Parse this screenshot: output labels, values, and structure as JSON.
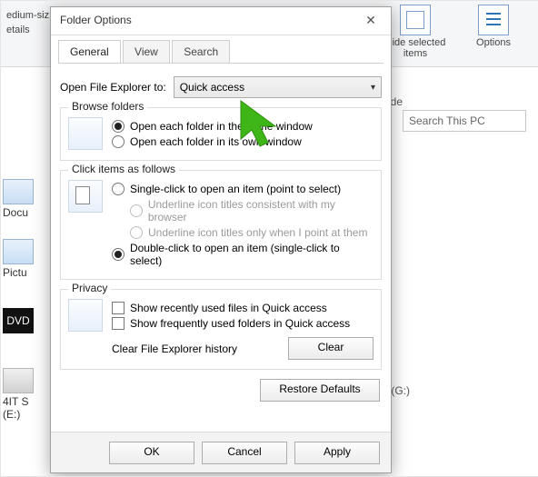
{
  "ribbon": {
    "frag_size": "edium-siz",
    "frag_details": "etails",
    "hide_label_l1": "Hide selected",
    "hide_label_l2": "items",
    "options_label": "Options"
  },
  "bg": {
    "ide": "ide",
    "search_placeholder": "Search This PC",
    "docu": "Docu",
    "pictu": "Pictu",
    "dvd": "DVD",
    "fourit": "4IT S",
    "e_drive": "(E:)",
    "g_drive": "(G:)"
  },
  "dialog": {
    "title": "Folder Options",
    "tabs": {
      "general": "General",
      "view": "View",
      "search": "Search"
    },
    "open_to_label": "Open File Explorer to:",
    "open_to_value": "Quick access",
    "browse": {
      "legend": "Browse folders",
      "same": "Open each folder in the same window",
      "own": "Open each folder in its own window"
    },
    "click": {
      "legend": "Click items as follows",
      "single": "Single-click to open an item (point to select)",
      "ul_browser": "Underline icon titles consistent with my browser",
      "ul_point": "Underline icon titles only when I point at them",
      "double": "Double-click to open an item (single-click to select)"
    },
    "privacy": {
      "legend": "Privacy",
      "recent_files": "Show recently used files in Quick access",
      "freq_folders": "Show frequently used folders in Quick access",
      "clear_label": "Clear File Explorer history",
      "clear_btn": "Clear"
    },
    "restore": "Restore Defaults",
    "ok": "OK",
    "cancel": "Cancel",
    "apply": "Apply"
  }
}
